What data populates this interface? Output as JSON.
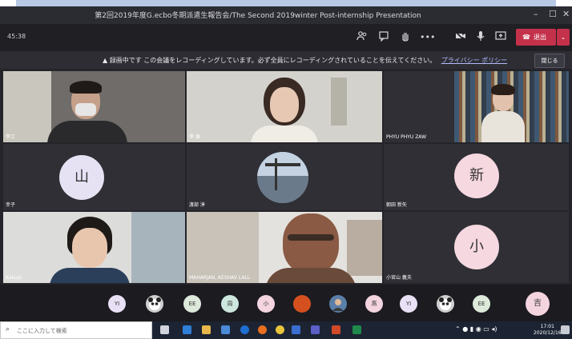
{
  "window": {
    "title": "第2回2019年度G.ecbo冬期派遣生報告会/The Second 2019winter Post-internship Presentation",
    "minimize": "–",
    "maximize": "☐",
    "close": "✕"
  },
  "toolbar": {
    "duration": "45:38",
    "leave_label": "退出",
    "leave_color": "#c4314b"
  },
  "recording_banner": {
    "text": "録画中です この会議をレコーディングしています。必ず全員にレコーディングされていることを伝えてください。",
    "privacy_link": "プライバシー ポリシー",
    "close_label": "閉じる"
  },
  "participants": [
    {
      "label": "李江",
      "type": "video"
    },
    {
      "label": "李 源",
      "type": "video"
    },
    {
      "label": "PHYU PHYU ZAW",
      "type": "video"
    },
    {
      "label": "幸子",
      "type": "initial",
      "initial": "山"
    },
    {
      "label": "渡部 淳",
      "type": "photo"
    },
    {
      "label": "朝田 新矢",
      "type": "initial",
      "initial": "新"
    },
    {
      "label": "Kakujo",
      "type": "video"
    },
    {
      "label": "MAHARJAN, KESHAV LALL",
      "type": "video"
    },
    {
      "label": "小宮山 義夫",
      "type": "initial",
      "initial": "小"
    }
  ],
  "tray": [
    {
      "label": "YI",
      "color": "#e8e0f4"
    },
    {
      "label": "",
      "icon": "panda-avatar-icon",
      "color": "#d0d0d0"
    },
    {
      "label": "EE",
      "color": "#dde9da"
    },
    {
      "label": "周",
      "color": "#cde6de"
    },
    {
      "label": "小",
      "color": "#f4d4de"
    },
    {
      "label": "",
      "icon": "sunset-avatar-icon",
      "color": "#d4501e"
    },
    {
      "label": "",
      "icon": "person-avatar-icon",
      "color": "#5a7fa8"
    },
    {
      "label": "燕",
      "color": "#f4d4de"
    },
    {
      "label": "YI",
      "color": "#e8e0f4"
    },
    {
      "label": "",
      "icon": "panda-avatar-icon",
      "color": "#d0d0d0"
    },
    {
      "label": "EE",
      "color": "#dde9da"
    },
    {
      "label": "吉",
      "color": "#f4d4de"
    }
  ],
  "taskbar": {
    "search_placeholder": "ここに入力して検索",
    "time": "17:01",
    "date": "2020/12/16"
  }
}
